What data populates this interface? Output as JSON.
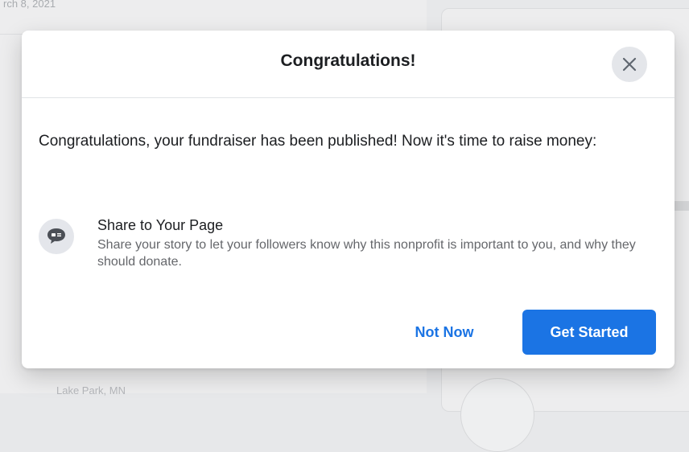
{
  "background": {
    "date_fragment": "rch 8, 2021",
    "footer_fragment": "Lake Park, MN"
  },
  "modal": {
    "title": "Congratulations!",
    "close_icon": "close-icon",
    "body_text": "Congratulations, your fundraiser has been published! Now it's time to raise money:",
    "option": {
      "icon": "chat-bubble-icon",
      "title": "Share to Your Page",
      "description": "Share your story to let your followers know why this nonprofit is important to you, and why they should donate."
    },
    "buttons": {
      "not_now": "Not Now",
      "get_started": "Get Started"
    }
  },
  "colors": {
    "primary": "#1b74e4",
    "text": "#1c1e21",
    "secondary_text": "#65676b"
  }
}
